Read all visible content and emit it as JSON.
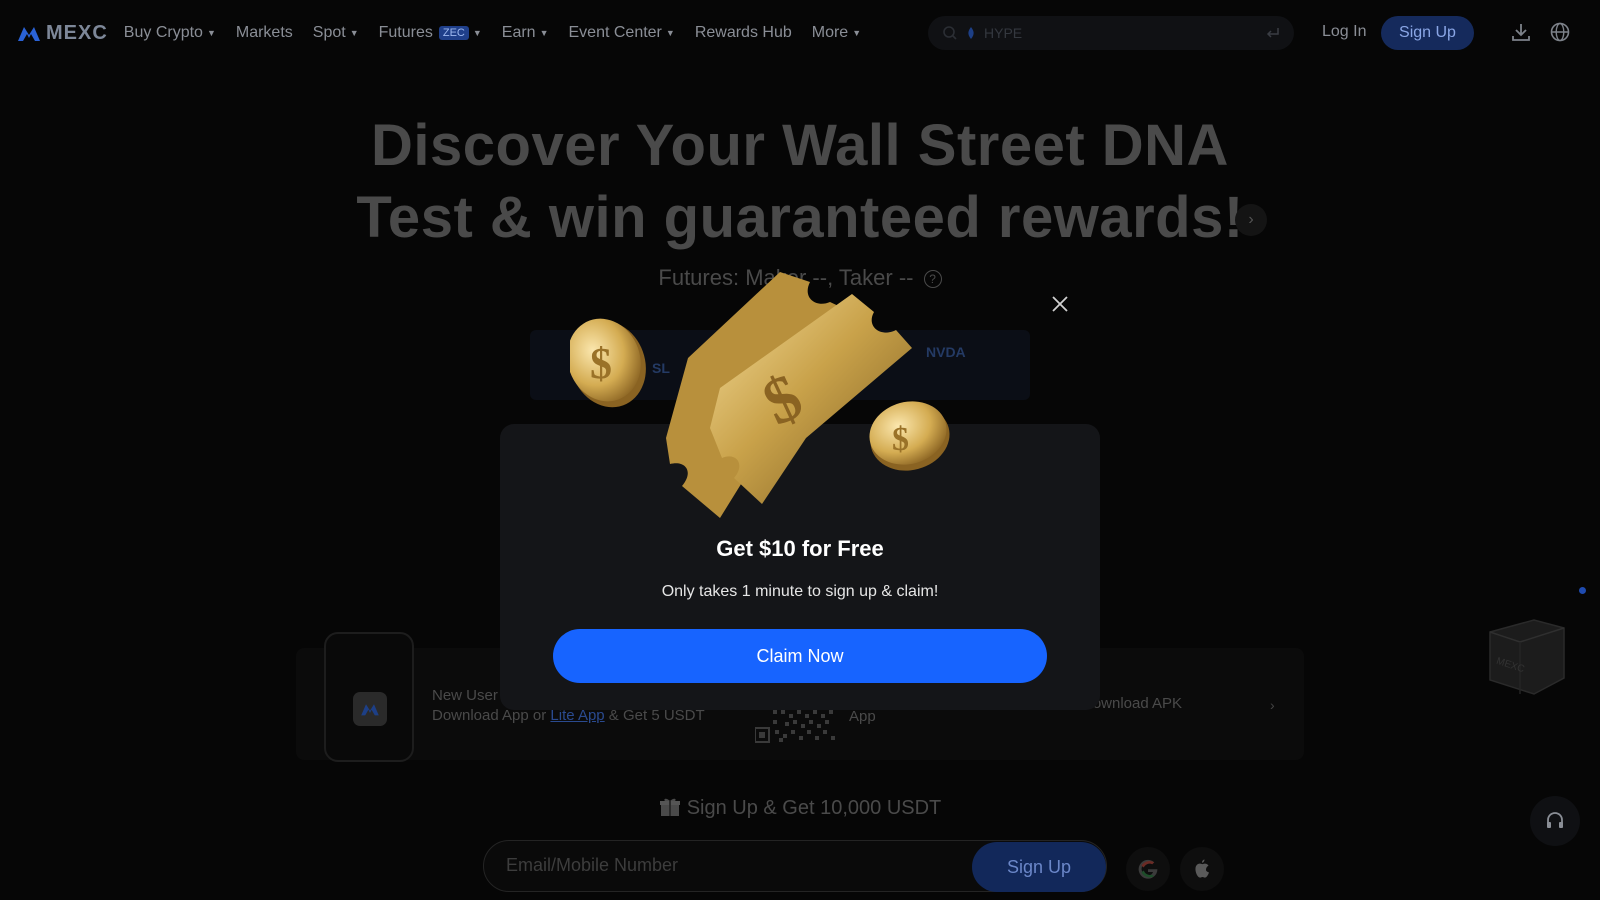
{
  "header": {
    "logo_text": "MEXC",
    "nav": {
      "buy_crypto": "Buy Crypto",
      "markets": "Markets",
      "spot": "Spot",
      "futures": "Futures",
      "futures_badge": "ZEC",
      "earn": "Earn",
      "event_center": "Event Center",
      "rewards_hub": "Rewards Hub",
      "more": "More"
    },
    "search_placeholder": "HYPE",
    "login": "Log In",
    "signup": "Sign Up"
  },
  "hero": {
    "title_line1": "Discover Your Wall Street DNA",
    "title_line2": "Test & win guaranteed rewards!",
    "fee_line": "Futures: Maker --, Taker --",
    "tickers": [
      "SL",
      "NVDA"
    ]
  },
  "download": {
    "line1": "New User",
    "line2_prefix": "Download App or ",
    "line2_link": "Lite App",
    "line2_suffix": " & Get 5 USDT",
    "app_label": "App",
    "apk_label": "Download APK"
  },
  "signup_section": {
    "headline": "Sign Up & Get 10,000 USDT",
    "email_placeholder": "Email/Mobile Number",
    "button": "Sign Up"
  },
  "modal": {
    "title": "Get $10 for Free",
    "subtitle": "Only takes 1 minute to sign up & claim!",
    "button": "Claim Now"
  },
  "colors": {
    "accent": "#1764ff",
    "coin_gold": "#c9a24a",
    "background": "#060606"
  }
}
